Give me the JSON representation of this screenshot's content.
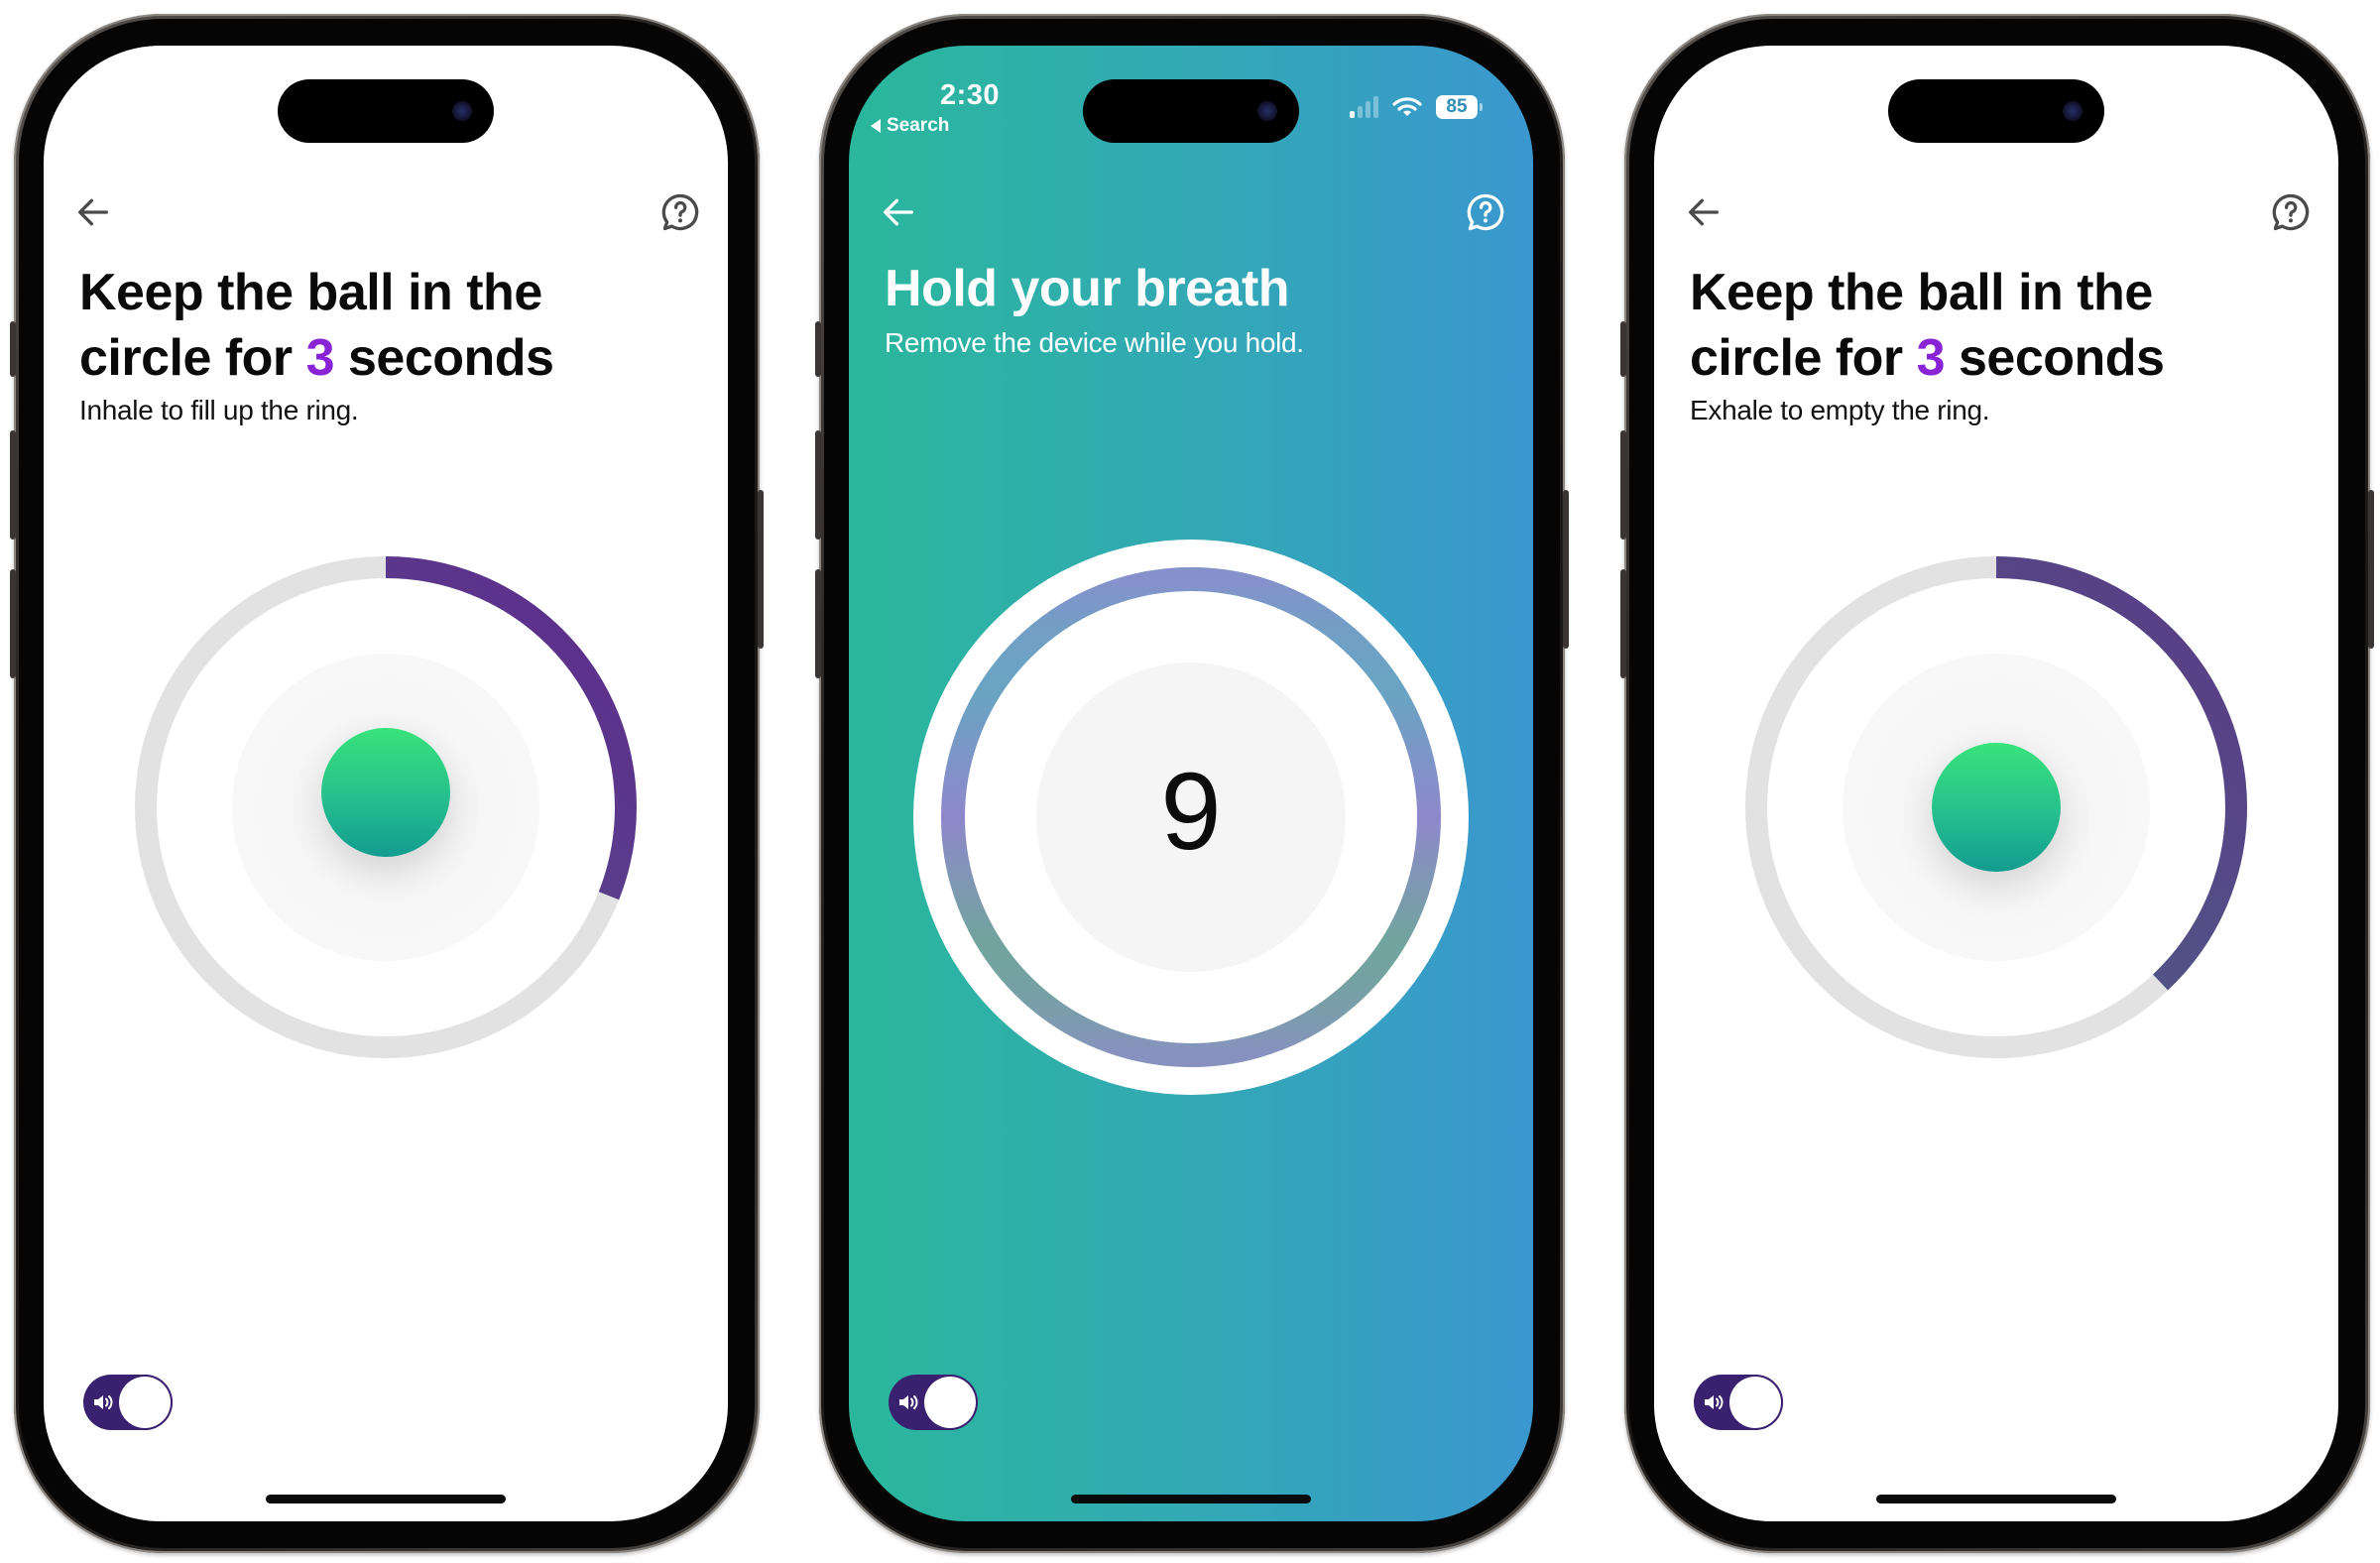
{
  "colors": {
    "accent_purple": "#8a22d6",
    "toggle_bg": "#3a2170",
    "ring_track": "#e2e2e2",
    "ring_progress_start": "#4d5f8a",
    "ring_progress_end": "#5f2a8c",
    "teal_bg_start": "#2ab79c",
    "teal_bg_end": "#3a97cf",
    "ball_top": "#38e37a",
    "ball_bottom": "#129c90"
  },
  "phones": [
    {
      "theme": "light",
      "nav": {
        "back_icon": "arrow-left-icon",
        "help_icon": "help-chat-icon"
      },
      "title_line1": "Keep the ball in the",
      "title_line2_prefix": "circle for ",
      "title_highlight": "3",
      "title_line2_suffix": " seconds",
      "subtitle": "Inhale to fill up the ring.",
      "ring_progress": 0.31,
      "sound_toggle": {
        "icon": "speaker-icon",
        "on": true
      }
    },
    {
      "theme": "teal",
      "status_bar": {
        "time": "2:30",
        "back_label": "Search",
        "signal_bars_total": 4,
        "signal_bars_active": 1,
        "wifi": true,
        "battery": "85"
      },
      "nav": {
        "back_icon": "arrow-left-icon",
        "help_icon": "help-chat-icon"
      },
      "title": "Hold your breath",
      "subtitle": "Remove the device while you hold.",
      "countdown": "9",
      "ring_progress": 1.0,
      "sound_toggle": {
        "icon": "speaker-icon",
        "on": true
      }
    },
    {
      "theme": "light",
      "nav": {
        "back_icon": "arrow-left-icon",
        "help_icon": "help-chat-icon"
      },
      "title_line1": "Keep the ball in the",
      "title_line2_prefix": "circle for ",
      "title_highlight": "3",
      "title_line2_suffix": " seconds",
      "subtitle": "Exhale to empty the ring.",
      "ring_progress": 0.38,
      "sound_toggle": {
        "icon": "speaker-icon",
        "on": true
      }
    }
  ]
}
